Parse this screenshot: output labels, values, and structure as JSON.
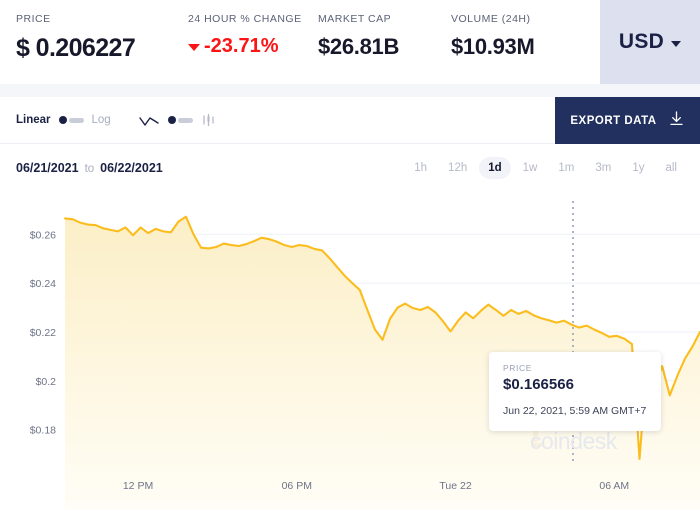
{
  "header": {
    "stats": [
      {
        "label": "PRICE",
        "value": "$ 0.206227",
        "name": "price"
      },
      {
        "label": "24 HOUR % CHANGE",
        "value": "-23.71%",
        "name": "change",
        "direction": "down",
        "color": "#fc1414"
      },
      {
        "label": "MARKET CAP",
        "value": "$26.81B",
        "name": "market-cap"
      },
      {
        "label": "VOLUME (24H)",
        "value": "$10.93M",
        "name": "volume"
      }
    ],
    "currency": {
      "label": "USD",
      "icon": "caret-down-icon"
    }
  },
  "toolbar": {
    "scale": {
      "linear_label": "Linear",
      "log_label": "Log",
      "selected": "Linear"
    },
    "chart_type": {
      "line_icon": "line-chart-icon",
      "candle_icon": "candlestick-chart-icon",
      "selected": "line"
    },
    "export": {
      "label": "EXPORT DATA",
      "icon": "download-icon"
    }
  },
  "daterow": {
    "start_date": "06/21/2021",
    "separator": "to",
    "end_date": "06/22/2021",
    "ranges": [
      "1h",
      "12h",
      "1d",
      "1w",
      "1m",
      "3m",
      "1y",
      "all"
    ],
    "active_range": "1d"
  },
  "tooltip": {
    "label": "PRICE",
    "price": "$0.166566",
    "date": "Jun 22, 2021, 5:59 AM GMT+7"
  },
  "watermark": {
    "text": "coindesk"
  },
  "chart_data": {
    "type": "area",
    "title": "",
    "xlabel": "",
    "ylabel": "",
    "line_color": "#fbbd1e",
    "fill_top_color": "#fcefc7",
    "fill_bottom_color": "#fffdf6",
    "grid": true,
    "legend_position": "none",
    "ylim": [
      0.17,
      0.272
    ],
    "ytick_values": [
      0.26,
      0.24,
      0.22,
      0.2,
      0.18
    ],
    "ytick_labels": [
      "$0.26",
      "$0.24",
      "$0.22",
      "$0.2",
      "$0.18"
    ],
    "xtick_labels": [
      "12 PM",
      "06 PM",
      "Tue 22",
      "06 AM"
    ],
    "xtick_positions": [
      0.115,
      0.365,
      0.615,
      0.865
    ],
    "crosshair_x": 0.8,
    "crosshair_value": 0.166566,
    "values": [
      0.2665,
      0.2662,
      0.2648,
      0.264,
      0.2638,
      0.2625,
      0.2618,
      0.2612,
      0.2628,
      0.2596,
      0.2628,
      0.2605,
      0.2622,
      0.2612,
      0.2608,
      0.2652,
      0.2672,
      0.26,
      0.2545,
      0.2542,
      0.2548,
      0.2562,
      0.2556,
      0.2552,
      0.256,
      0.2572,
      0.2586,
      0.258,
      0.257,
      0.2556,
      0.2548,
      0.2556,
      0.2552,
      0.254,
      0.2534,
      0.2502,
      0.2466,
      0.243,
      0.24,
      0.2372,
      0.229,
      0.221,
      0.2168,
      0.2254,
      0.23,
      0.2316,
      0.2298,
      0.229,
      0.2302,
      0.228,
      0.2244,
      0.2202,
      0.2246,
      0.228,
      0.2256,
      0.2286,
      0.2312,
      0.229,
      0.2266,
      0.229,
      0.2274,
      0.2286,
      0.2268,
      0.2256,
      0.2248,
      0.2238,
      0.2246,
      0.223,
      0.2218,
      0.2226,
      0.221,
      0.2196,
      0.218,
      0.2184,
      0.2172,
      0.215,
      0.168,
      0.208,
      0.198,
      0.206,
      0.194,
      0.202,
      0.209,
      0.214,
      0.22
    ]
  }
}
